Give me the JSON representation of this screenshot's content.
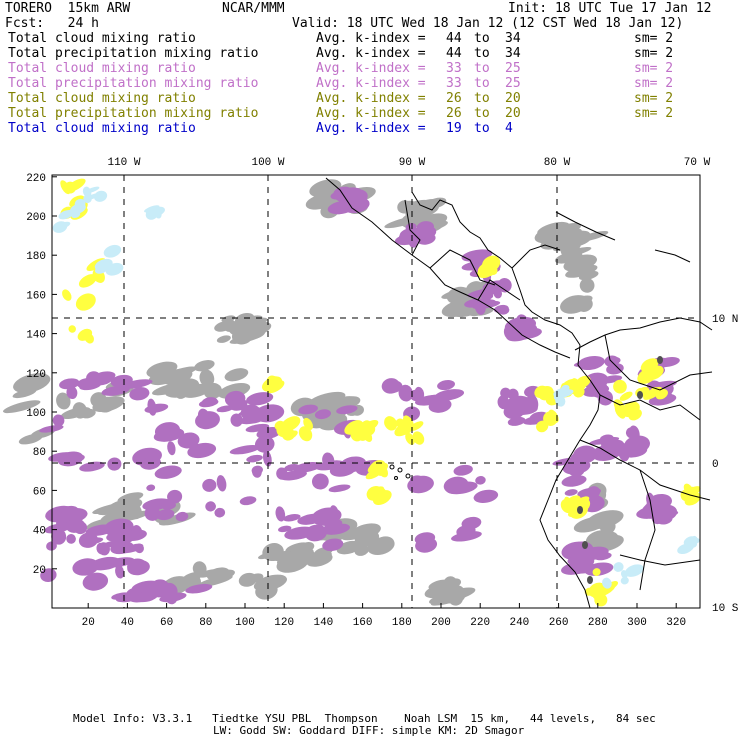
{
  "header": {
    "model": "TORERO  15km ARW",
    "center": "NCAR/MMM",
    "init": "Init: 18 UTC Tue 17 Jan 12",
    "fcst": "Fcst:   24 h",
    "valid": "Valid: 18 UTC Wed 18 Jan 12 (12 CST Wed 18 Jan 12)"
  },
  "legend": [
    {
      "field": "Total cloud mixing ratio",
      "kidx": "Avg. k-index =",
      "from": "44",
      "to_word": "to",
      "to": "34",
      "sm": "sm= 2",
      "color": "#000000"
    },
    {
      "field": "Total precipitation mixing ratio",
      "kidx": "Avg. k-index =",
      "from": "44",
      "to_word": "to",
      "to": "34",
      "sm": "sm= 2",
      "color": "#000000"
    },
    {
      "field": "Total cloud mixing ratio",
      "kidx": "Avg. k-index =",
      "from": "33",
      "to_word": "to",
      "to": "25",
      "sm": "sm= 2",
      "color": "#c070c8"
    },
    {
      "field": "Total precipitation mixing ratio",
      "kidx": "Avg. k-index =",
      "from": "33",
      "to_word": "to",
      "to": "25",
      "sm": "sm= 2",
      "color": "#c070c8"
    },
    {
      "field": "Total cloud mixing ratio",
      "kidx": "Avg. k-index =",
      "from": "26",
      "to_word": "to",
      "to": "20",
      "sm": "sm= 2",
      "color": "#808000"
    },
    {
      "field": "Total precipitation mixing ratio",
      "kidx": "Avg. k-index =",
      "from": "26",
      "to_word": "to",
      "to": "20",
      "sm": "sm= 2",
      "color": "#808000"
    },
    {
      "field": "Total cloud mixing ratio",
      "kidx": "Avg. k-index =",
      "from": "19",
      "to_word": "to",
      "to": "4",
      "sm": "",
      "color": "#0000c8"
    }
  ],
  "lon_labels": [
    "110 W",
    "100 W",
    "90 W",
    "80 W",
    "70 W"
  ],
  "lat_labels": [
    "10 N",
    "0",
    "10 S"
  ],
  "y_ticks": [
    "220",
    "200",
    "180",
    "160",
    "140",
    "120",
    "100",
    "80",
    "60",
    "40",
    "20"
  ],
  "x_ticks": [
    "20",
    "40",
    "60",
    "80",
    "100",
    "120",
    "140",
    "160",
    "180",
    "200",
    "220",
    "240",
    "260",
    "280",
    "300",
    "320"
  ],
  "footer": {
    "line1": "Model Info: V3.3.1   Tiedtke YSU PBL  Thompson    Noah LSM  15 km,   44 levels,   84 sec",
    "line2": "LW: Godd SW: Goddard DIFF: simple KM: 2D Smagor"
  },
  "colors": {
    "gray": "#a8a8a8",
    "purple": "#b070c0",
    "yellow": "#ffff40",
    "lightblue": "#c8ecf8",
    "dark": "#505050"
  }
}
